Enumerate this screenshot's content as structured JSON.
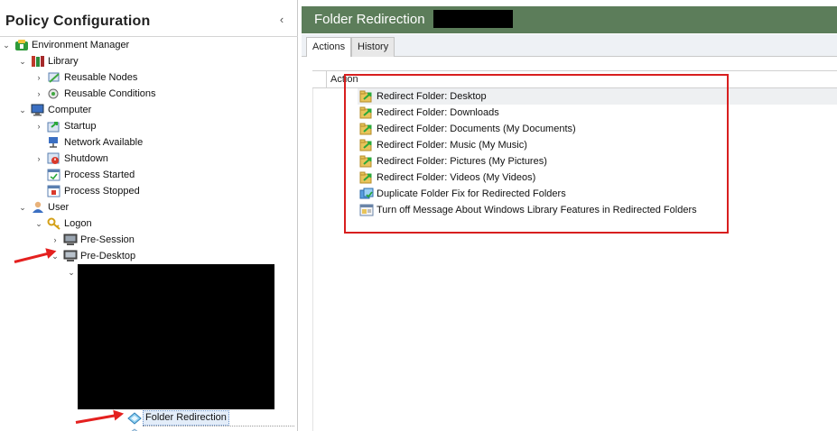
{
  "left_pane": {
    "title": "Policy Configuration",
    "collapse_glyph": "‹"
  },
  "tree": [
    {
      "id": "environment-manager",
      "label": "Environment Manager",
      "chevron": "⌄",
      "icon": "environment-manager-icon",
      "depth": 0
    },
    {
      "id": "library",
      "label": "Library",
      "chevron": "⌄",
      "icon": "library-icon",
      "depth": 1
    },
    {
      "id": "reusable-nodes",
      "label": "Reusable Nodes",
      "chevron": "›",
      "icon": "reusable-nodes-icon",
      "depth": 2
    },
    {
      "id": "reusable-conditions",
      "label": "Reusable Conditions",
      "chevron": "›",
      "icon": "reusable-conditions-icon",
      "depth": 2
    },
    {
      "id": "computer",
      "label": "Computer",
      "chevron": "⌄",
      "icon": "computer-icon",
      "depth": 1
    },
    {
      "id": "startup",
      "label": "Startup",
      "chevron": "›",
      "icon": "startup-icon",
      "depth": 2
    },
    {
      "id": "network-available",
      "label": "Network Available",
      "chevron": "",
      "icon": "network-available-icon",
      "depth": 2
    },
    {
      "id": "shutdown",
      "label": "Shutdown",
      "chevron": "›",
      "icon": "shutdown-icon",
      "depth": 2
    },
    {
      "id": "process-started",
      "label": "Process Started",
      "chevron": "",
      "icon": "process-started-icon",
      "depth": 2
    },
    {
      "id": "process-stopped",
      "label": "Process Stopped",
      "chevron": "",
      "icon": "process-stopped-icon",
      "depth": 2
    },
    {
      "id": "user",
      "label": "User",
      "chevron": "⌄",
      "icon": "user-icon",
      "depth": 1
    },
    {
      "id": "logon",
      "label": "Logon",
      "chevron": "⌄",
      "icon": "logon-icon",
      "depth": 2
    },
    {
      "id": "pre-session",
      "label": "Pre-Session",
      "chevron": "›",
      "icon": "pre-session-icon",
      "depth": 3
    },
    {
      "id": "pre-desktop",
      "label": "Pre-Desktop",
      "chevron": "⌄",
      "icon": "pre-desktop-icon",
      "depth": 3
    }
  ],
  "selected_node": {
    "label": "Folder Redirection",
    "icon": "folder-redirection-icon"
  },
  "right_pane": {
    "title": "Folder Redirection",
    "header_color": "#5c7d5a",
    "tabs": [
      {
        "label": "Actions",
        "active": true
      },
      {
        "label": "History",
        "active": false
      }
    ],
    "column_header": "Action",
    "actions": [
      {
        "label": "Redirect Folder: Desktop",
        "icon": "redirect-folder-icon"
      },
      {
        "label": "Redirect Folder: Downloads",
        "icon": "redirect-folder-icon"
      },
      {
        "label": "Redirect Folder: Documents (My Documents)",
        "icon": "redirect-folder-icon"
      },
      {
        "label": "Redirect Folder: Music (My Music)",
        "icon": "redirect-folder-icon"
      },
      {
        "label": "Redirect Folder: Pictures (My Pictures)",
        "icon": "redirect-folder-icon"
      },
      {
        "label": "Redirect Folder: Videos (My Videos)",
        "icon": "redirect-folder-icon"
      },
      {
        "label": "Duplicate Folder Fix for Redirected Folders",
        "icon": "duplicate-folder-fix-icon"
      },
      {
        "label": "Turn off Message About Windows Library Features in Redirected Folders",
        "icon": "library-message-icon"
      }
    ]
  },
  "annotation_color": "#d81f1f"
}
